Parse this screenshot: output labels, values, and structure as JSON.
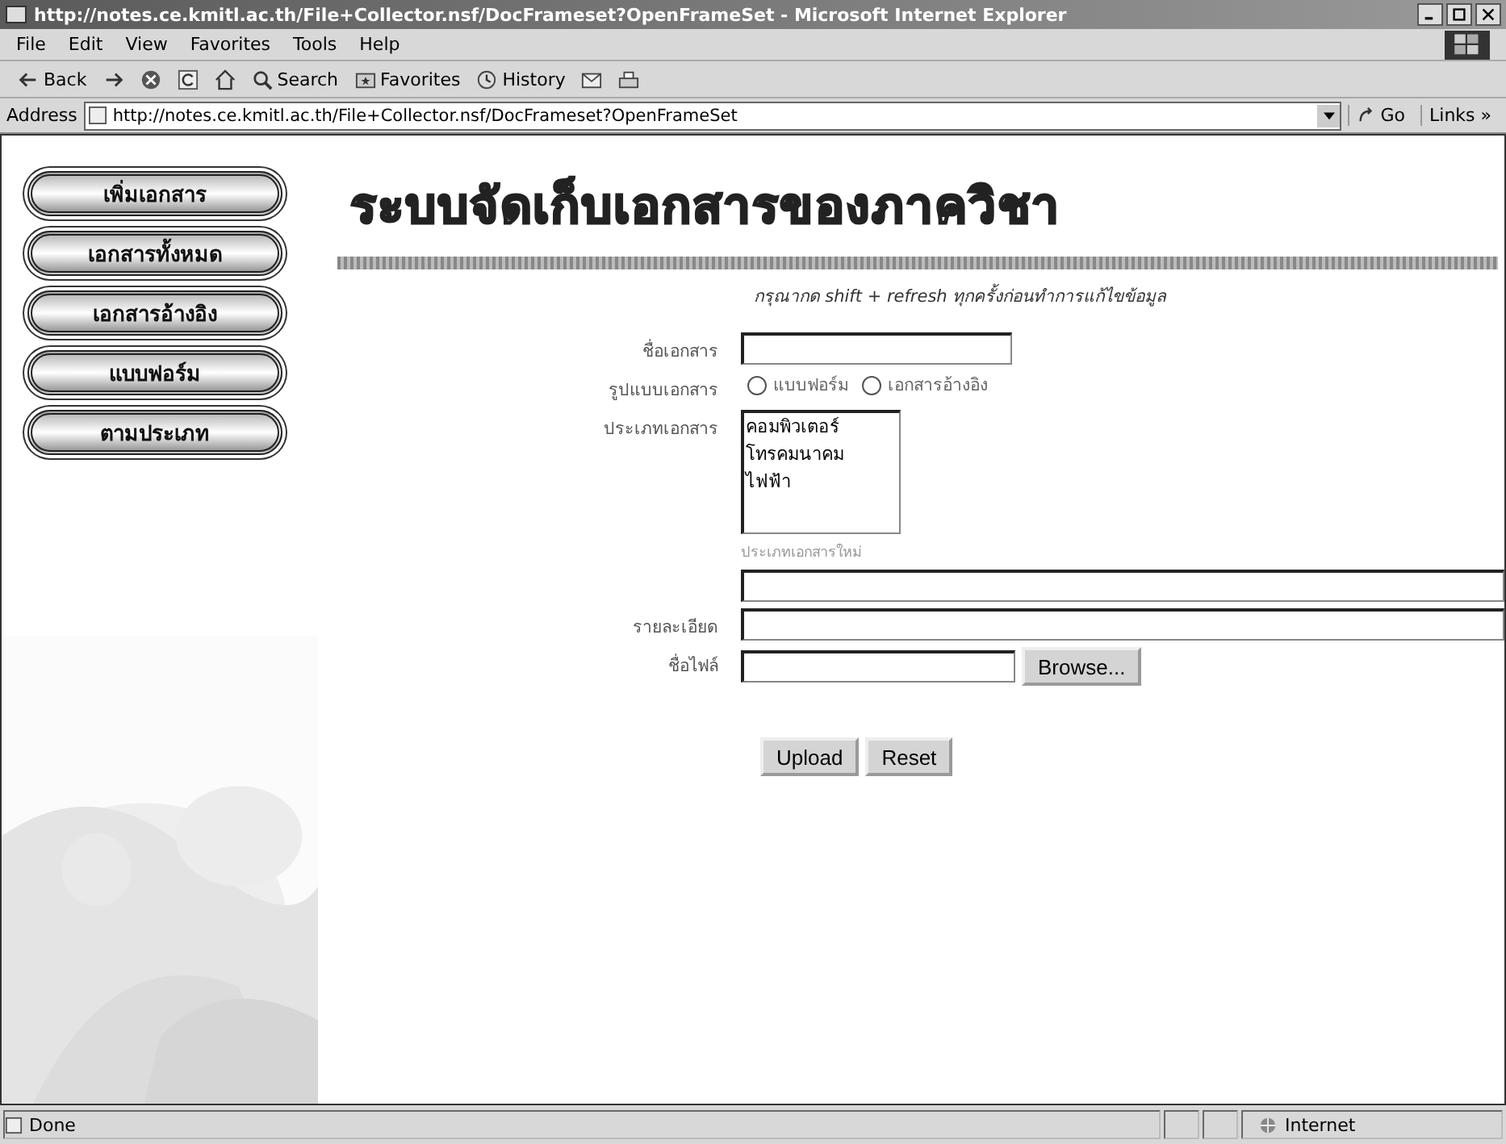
{
  "window": {
    "title": "http://notes.ce.kmitl.ac.th/File+Collector.nsf/DocFrameset?OpenFrameSet - Microsoft Internet Explorer"
  },
  "menu": [
    "File",
    "Edit",
    "View",
    "Favorites",
    "Tools",
    "Help"
  ],
  "toolbar": [
    {
      "kind": "back",
      "label": "Back"
    },
    {
      "kind": "forward"
    },
    {
      "kind": "stop"
    },
    {
      "kind": "refresh"
    },
    {
      "kind": "home"
    },
    {
      "kind": "search",
      "label": "Search"
    },
    {
      "kind": "favorites",
      "label": "Favorites"
    },
    {
      "kind": "history",
      "label": "History"
    },
    {
      "kind": "mail"
    },
    {
      "kind": "print"
    }
  ],
  "address_bar": {
    "label": "Address",
    "value": "http://notes.ce.kmitl.ac.th/File+Collector.nsf/DocFrameset?OpenFrameSet",
    "go": "Go",
    "links": "Links »"
  },
  "sidebar": {
    "buttons": [
      "เพิ่มเอกสาร",
      "เอกสารทั้งหมด",
      "เอกสารอ้างอิง",
      "แบบฟอร์ม",
      "ตามประเภท"
    ]
  },
  "page": {
    "title": "ระบบจัดเก็บเอกสารของภาควิชา",
    "hint": "กรุณากด shift + refresh ทุกครั้งก่อนทำการแก้ไขข้อมูล",
    "name_label": "ชื่อเอกสาร",
    "format_label": "รูปแบบเอกสาร",
    "format_options": [
      {
        "label": "แบบฟอร์ม",
        "selected": false
      },
      {
        "label": "เอกสารอ้างอิง",
        "selected": false
      }
    ],
    "type_label": "ประเภทเอกสาร",
    "type_options": [
      {
        "label": "คอมพิวเตอร์",
        "selected": false
      },
      {
        "label": "โทรคมนาคม",
        "selected": false
      },
      {
        "label": "ไฟฟ้า",
        "selected": false
      }
    ],
    "new_type_label": "ประเภทเอกสารใหม่",
    "detail_label": "รายละเอียด",
    "file_label": "ชื่อไฟล์",
    "browse": "Browse...",
    "buttons": [
      "Upload",
      "Reset"
    ]
  },
  "status_bar": {
    "text": "Done",
    "zone": "Internet"
  }
}
